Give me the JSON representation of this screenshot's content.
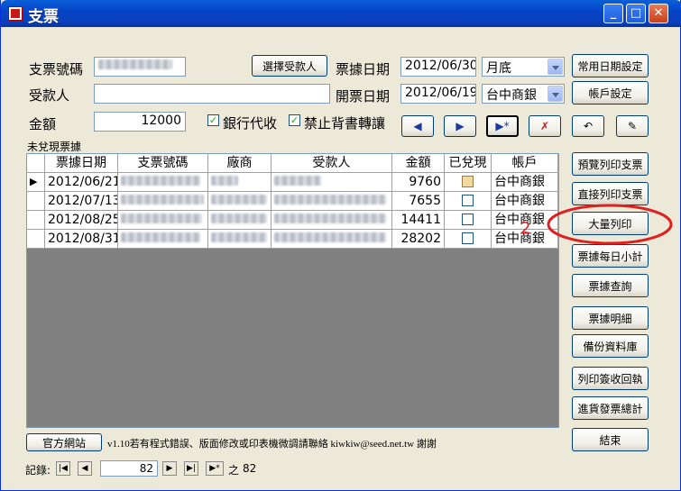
{
  "window": {
    "title": "支票"
  },
  "form": {
    "check_no_label": "支票號碼",
    "select_payee_label": "選擇受款人",
    "check_date_label": "票據日期",
    "check_date_value": "2012/06/30",
    "period_value": "月底",
    "common_date_setting_label": "常用日期設定",
    "payee_label": "受款人",
    "issue_date_label": "開票日期",
    "issue_date_value": "2012/06/19",
    "bank_value": "台中商銀",
    "account_setting_label": "帳戶設定",
    "amount_label": "金額",
    "amount_value": "12000",
    "bank_collect_label": "銀行代收",
    "bank_collect_checked": true,
    "no_endorse_label": "禁止背書轉讓",
    "no_endorse_checked": true
  },
  "nav_buttons": [
    {
      "name": "prev-record-icon",
      "glyph": "◀"
    },
    {
      "name": "next-record-icon",
      "glyph": "▶"
    },
    {
      "name": "new-record-icon",
      "glyph": "▶*"
    },
    {
      "name": "delete-record-icon",
      "glyph": "✗"
    },
    {
      "name": "undo-icon",
      "glyph": "↶"
    },
    {
      "name": "save-edit-icon",
      "glyph": "✎"
    }
  ],
  "grid": {
    "caption": "未兌現票據",
    "columns": [
      "票據日期",
      "支票號碼",
      "廠商",
      "受款人",
      "金額",
      "已兌現",
      "帳戶"
    ],
    "rows": [
      {
        "date": "2012/06/21",
        "amount": "9760",
        "cashed": true,
        "account": "台中商銀",
        "current": true
      },
      {
        "date": "2012/07/13",
        "amount": "7655",
        "cashed": false,
        "account": "台中商銀",
        "current": false
      },
      {
        "date": "2012/08/25",
        "amount": "14411",
        "cashed": false,
        "account": "台中商銀",
        "current": false
      },
      {
        "date": "2012/08/31",
        "amount": "28202",
        "cashed": false,
        "account": "台中商銀",
        "current": false
      }
    ]
  },
  "side_buttons": [
    "預覽列印支票",
    "直接列印支票",
    "大量列印",
    "票據每日小計",
    "票據查詢",
    "票據明細",
    "備份資料庫",
    "列印簽收回執",
    "進貨發票總計",
    "結束"
  ],
  "annotation": {
    "number": "2",
    "color": "#e02020"
  },
  "footer": {
    "website_label": "官方網站",
    "notice": "v1.10若有程式錯誤、版面修改或印表機微調請聯絡 kiwkiw@seed.net.tw 謝謝"
  },
  "record_nav": {
    "label": "記錄:",
    "current": "82",
    "of_label": "之",
    "total": "82"
  }
}
